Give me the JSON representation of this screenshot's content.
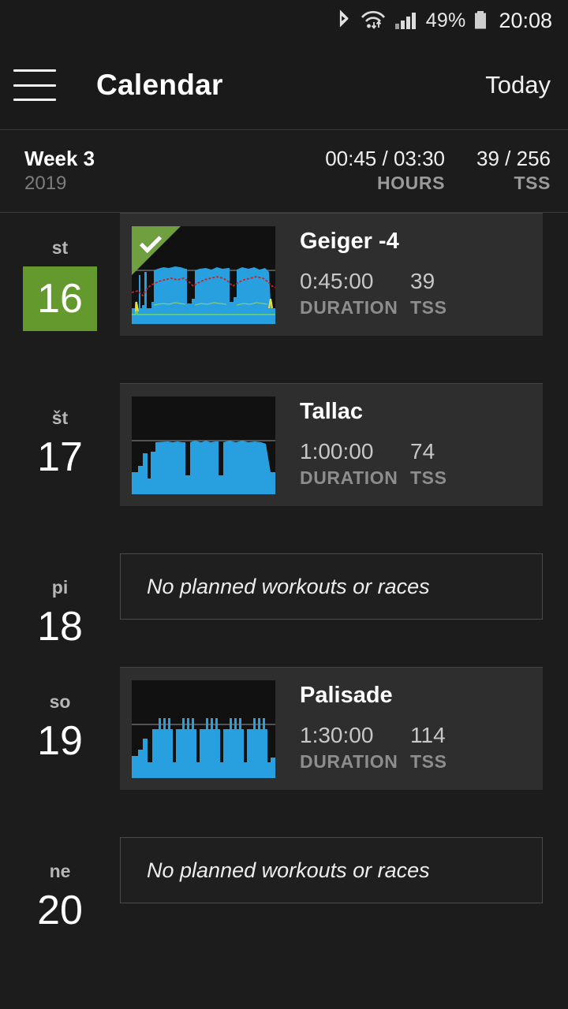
{
  "statusbar": {
    "icons": [
      "bluetooth-icon",
      "wifi-icon",
      "cellular-signal-icon",
      "battery-icon"
    ],
    "battery_percent": "49%",
    "clock": "20:08"
  },
  "appbar": {
    "menu_icon": "hamburger-menu-icon",
    "title": "Calendar",
    "action_label": "Today"
  },
  "week_summary": {
    "week_label": "Week 3",
    "year": "2019",
    "hours_value": "00:45 / 03:30",
    "hours_label": "HOURS",
    "tss_value": "39 / 256",
    "tss_label": "TSS"
  },
  "colors": {
    "accent_green": "#64992e",
    "power_blue": "#28a0df",
    "page_bg": "#1c1c1c",
    "card_bg": "#2e2e2e",
    "heartrate_red": "#cc2222"
  },
  "empty_text": "No planned workouts or races",
  "days": [
    {
      "dow": "st",
      "date": "16",
      "is_today": true,
      "has_workout": true,
      "completed": true,
      "workout": {
        "title": "Geiger -4",
        "duration": "0:45:00",
        "duration_label": "DURATION",
        "tss": "39",
        "tss_label": "TSS"
      }
    },
    {
      "dow": "št",
      "date": "17",
      "is_today": false,
      "has_workout": true,
      "completed": false,
      "workout": {
        "title": "Tallac",
        "duration": "1:00:00",
        "duration_label": "DURATION",
        "tss": "74",
        "tss_label": "TSS"
      }
    },
    {
      "dow": "pi",
      "date": "18",
      "is_today": false,
      "has_workout": false,
      "completed": false,
      "workout": null
    },
    {
      "dow": "so",
      "date": "19",
      "is_today": false,
      "has_workout": true,
      "completed": false,
      "workout": {
        "title": "Palisade",
        "duration": "1:30:00",
        "duration_label": "DURATION",
        "tss": "114",
        "tss_label": "TSS"
      }
    },
    {
      "dow": "ne",
      "date": "20",
      "is_today": false,
      "has_workout": false,
      "completed": false,
      "workout": null
    }
  ]
}
